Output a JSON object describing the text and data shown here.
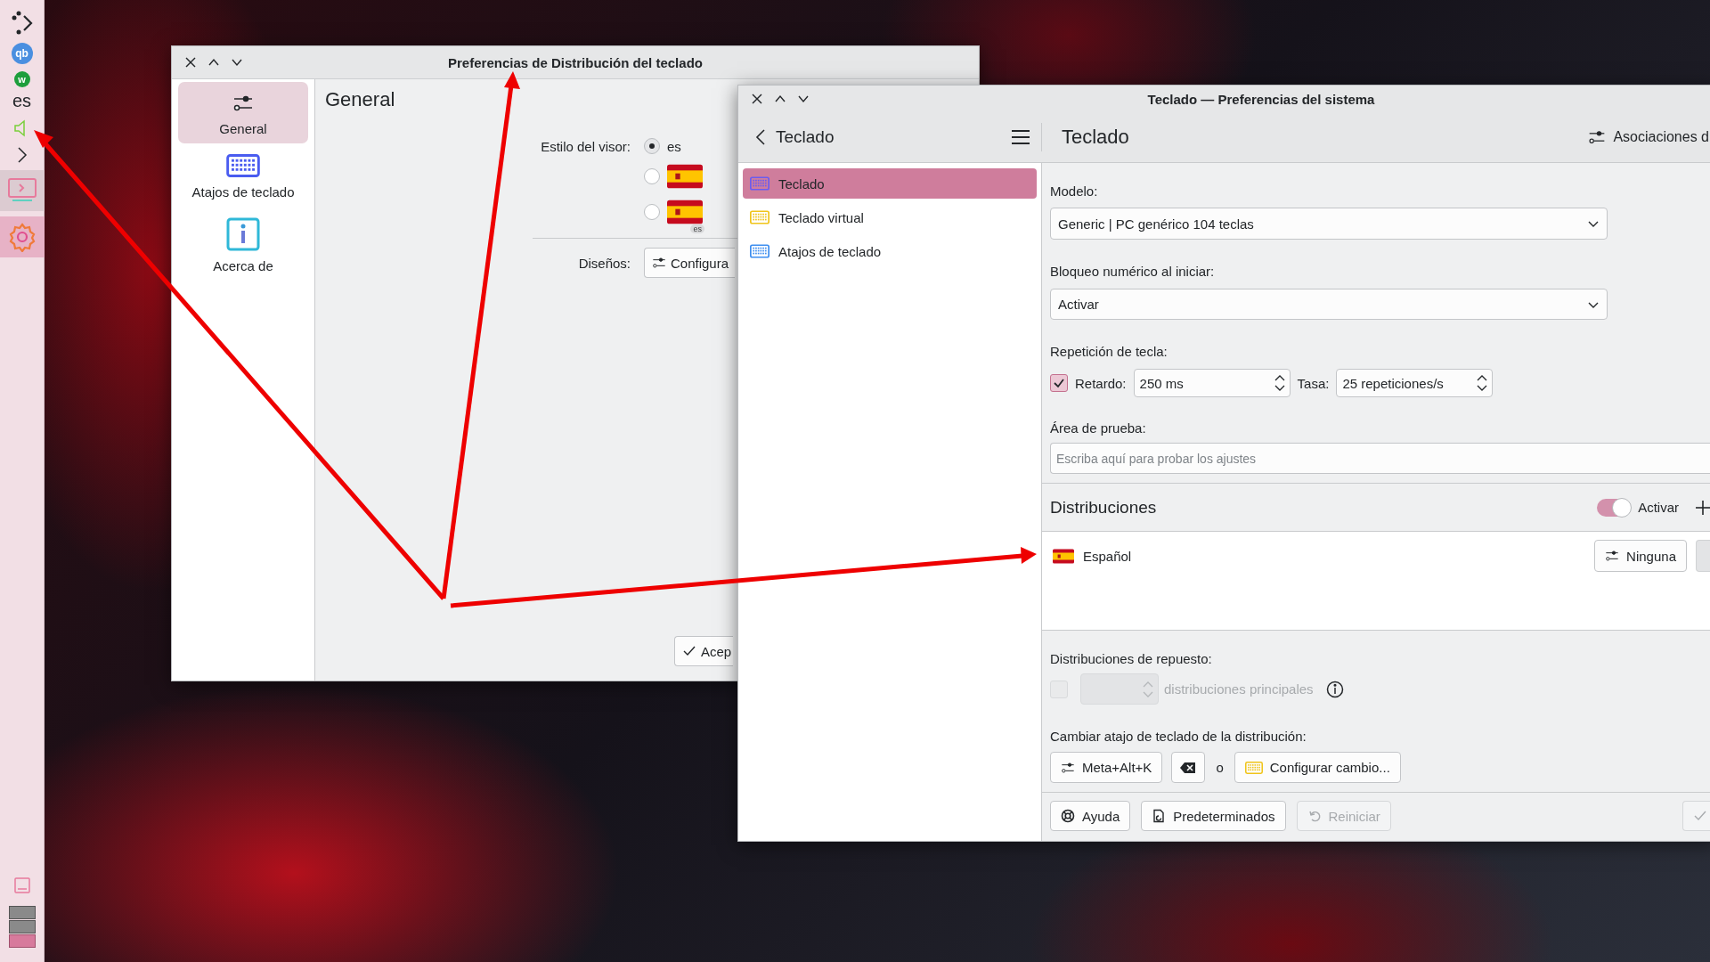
{
  "panel": {
    "tray_badges": [
      {
        "text": "qb",
        "color": "#4a8fe0"
      },
      {
        "text": "w",
        "color": "#1e9e3c"
      }
    ],
    "keyboard_layout": "es",
    "tasks": [
      {
        "kind": "remote",
        "selected": false
      },
      {
        "kind": "settings",
        "selected": true
      }
    ],
    "desktops": [
      {
        "selected": false
      },
      {
        "selected": false
      },
      {
        "selected": true
      }
    ]
  },
  "layout_window": {
    "title": "Preferencias de Distribución del teclado",
    "sidebar": [
      {
        "kind": "sliders",
        "label": "General",
        "selected": true
      },
      {
        "kind": "keyboard",
        "label": "Atajos de teclado",
        "selected": false
      },
      {
        "kind": "info",
        "label": "Acerca de",
        "selected": false
      }
    ],
    "heading": "General",
    "indicator_style": {
      "label": "Estilo del visor:",
      "options": [
        {
          "kind": "text",
          "text": "es",
          "selected": true
        },
        {
          "kind": "flag",
          "selected": false
        },
        {
          "kind": "flag_label",
          "badge": "es",
          "selected": false
        }
      ]
    },
    "layouts": {
      "label": "Diseños:",
      "button": "Configura"
    },
    "ok_button": "Acep"
  },
  "settings_window": {
    "title": "Teclado — Preferencias del sistema",
    "nav": {
      "back_title": "Teclado",
      "items": [
        {
          "kind": "keyboard",
          "label": "Teclado",
          "selected": true
        },
        {
          "kind": "virtual",
          "label": "Teclado virtual",
          "selected": false
        },
        {
          "kind": "shortcuts",
          "label": "Atajos de teclado",
          "selected": false
        }
      ]
    },
    "page_title": "Teclado",
    "header_action": "Asociaciones d",
    "model": {
      "label": "Modelo:",
      "value": "Generic | PC genérico 104 teclas"
    },
    "numlock": {
      "label": "Bloqueo numérico al iniciar:",
      "value": "Activar"
    },
    "repeat": {
      "label": "Repetición de tecla:",
      "checked": true,
      "delay_label": "Retardo:",
      "delay": "250 ms",
      "rate_label": "Tasa:",
      "rate": "25 repeticiones/s"
    },
    "test_area": {
      "label": "Área de prueba:",
      "placeholder": "Escriba aquí para probar los ajustes"
    },
    "layouts": {
      "title": "Distribuciones",
      "toggle_label": "Activar",
      "on": true,
      "items": [
        {
          "name": "Español",
          "shortcut": "Ninguna"
        }
      ]
    },
    "spare": {
      "label": "Distribuciones de repuesto:",
      "checked": false,
      "disabled": true,
      "text": "distribuciones principales"
    },
    "switch_shortcut": {
      "label": "Cambiar atajo de teclado de la distribución:",
      "shortcut": "Meta+Alt+K",
      "separator": "o",
      "configure": "Configurar cambio..."
    },
    "footer": [
      {
        "kind": "help",
        "label": "Ayuda",
        "disabled": false
      },
      {
        "kind": "defaults",
        "label": "Predeterminados",
        "disabled": false
      },
      {
        "kind": "reset",
        "label": "Reiniciar",
        "disabled": true
      },
      {
        "kind": "apply",
        "disabled": true
      }
    ]
  }
}
